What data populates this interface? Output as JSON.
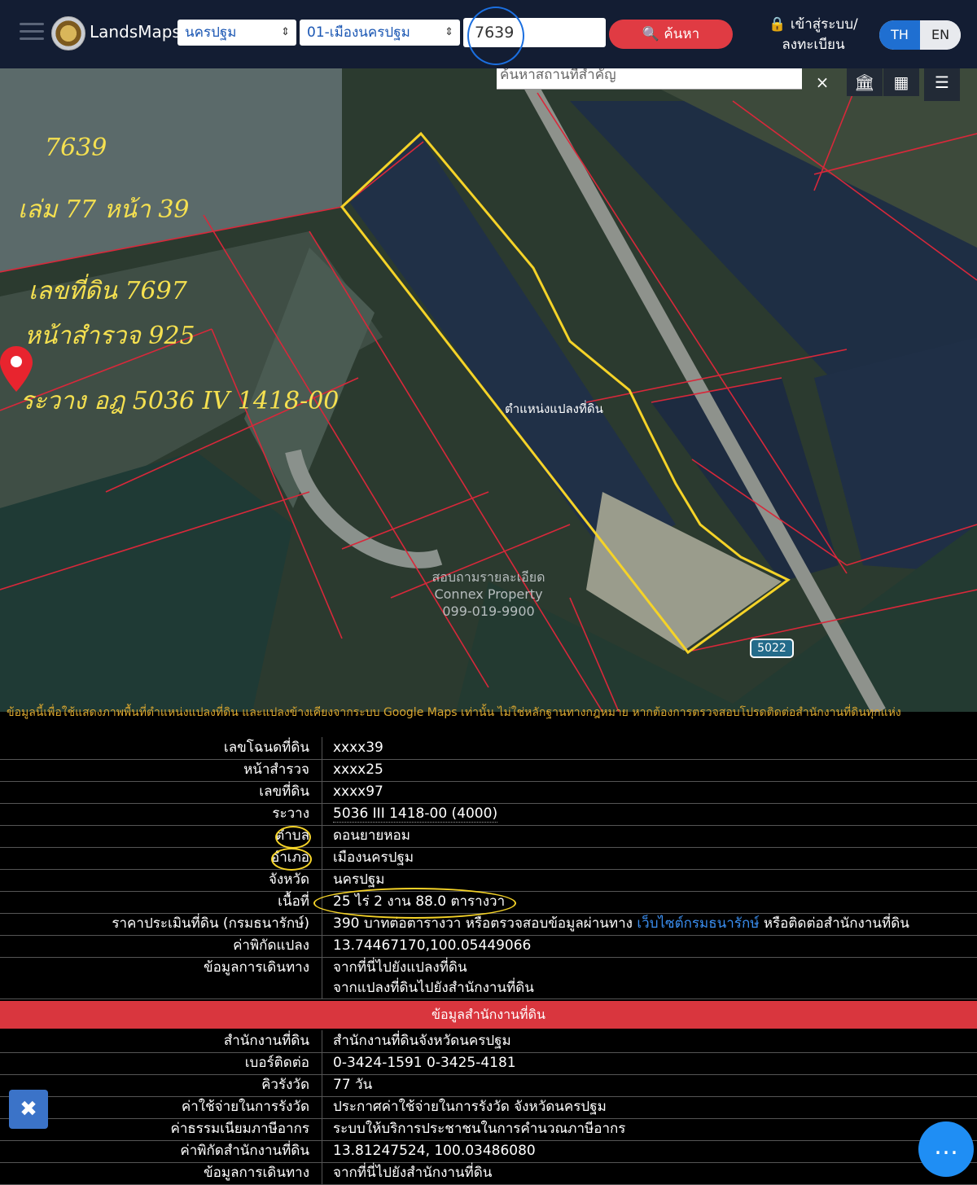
{
  "header": {
    "brand": "LandsMaps",
    "province_select": "นครปฐม",
    "district_select": "01-เมืองนครปฐม",
    "parcel_query": "7639",
    "search_button": "ค้นหา",
    "login": "เข้าสู่ระบบ/ลงทะเบียน",
    "lang_th": "TH",
    "lang_en": "EN"
  },
  "map": {
    "place_search_placeholder": "ค้นหาสถานที่สำคัญ",
    "clear_label": "×",
    "plot_label": "ตำแหน่งแปลงที่ดิน",
    "road_badge": "5022",
    "watermark_line1": "สอบถามรายละเอียด",
    "watermark_line2": "Connex Property",
    "watermark_line3": "099-019-9900",
    "handwritten": {
      "line1": "7639",
      "line2": "เล่ม 77 หน้า 39",
      "line3": "เลขที่ดิน 7697",
      "line4": "หน้าสำรวจ 925",
      "line5": "ระวาง  อฎ 5036 IV 1418-00"
    }
  },
  "disclaimer": "ข้อมูลนี้เพื่อใช้แสดงภาพพื้นที่ตำแหน่งแปลงที่ดิน และแปลงข้างเคียงจากระบบ Google Maps เท่านั้น ไม่ใช่หลักฐานทางกฎหมาย หากต้องการตรวจสอบโปรดติดต่อสำนักงานที่ดินทุกแห่ง",
  "parcel": [
    {
      "label": "เลขโฉนดที่ดิน",
      "value": "xxxx39"
    },
    {
      "label": "หน้าสำรวจ",
      "value": "xxxx25"
    },
    {
      "label": "เลขที่ดิน",
      "value": "xxxx97"
    },
    {
      "label": "ระวาง",
      "value": "5036 III 1418-00 (4000)"
    },
    {
      "label": "ตำบล",
      "value": "ดอนยายหอม"
    },
    {
      "label": "อำเภอ",
      "value": "เมืองนครปฐม"
    },
    {
      "label": "จังหวัด",
      "value": "นครปฐม"
    },
    {
      "label": "เนื้อที่",
      "value": "25 ไร่ 2 งาน 88.0 ตารางวา"
    }
  ],
  "price": {
    "label": "ราคาประเมินที่ดิน (กรมธนารักษ์)",
    "prefix": "390 บาทต่อตารางวา หรือตรวจสอบข้อมูลผ่านทาง ",
    "link": "เว็บไซต์กรมธนารักษ์",
    "suffix": " หรือติดต่อสำนักงานที่ดิน"
  },
  "coords": {
    "label": "ค่าพิกัดแปลง",
    "value": "13.74467170,100.05449066"
  },
  "travel": {
    "label": "ข้อมูลการเดินทาง",
    "link1": "จากที่นี่ไปยังแปลงที่ดิน",
    "link2": "จากแปลงที่ดินไปยังสำนักงานที่ดิน"
  },
  "office_section": {
    "title": "ข้อมูลสำนักงานที่ดิน",
    "rows": [
      {
        "label": "สำนักงานที่ดิน",
        "value": "สำนักงานที่ดินจังหวัดนครปฐม",
        "link": false
      },
      {
        "label": "เบอร์ติดต่อ",
        "value": "0-3424-1591 0-3425-4181",
        "link": true
      },
      {
        "label": "คิวรังวัด",
        "value": "77 วัน",
        "link": false
      },
      {
        "label": "ค่าใช้จ่ายในการรังวัด",
        "value": "ประกาศค่าใช้จ่ายในการรังวัด จังหวัดนครปฐม",
        "link": true
      },
      {
        "label": "ค่าธรรมเนียมภาษีอากร",
        "value": "ระบบให้บริการประชาชนในการคำนวณภาษีอากร",
        "link": true
      },
      {
        "label": "ค่าพิกัดสำนักงานที่ดิน",
        "value": "13.81247524, 100.03486080",
        "link": true
      },
      {
        "label": "ข้อมูลการเดินทาง",
        "value": "จากที่นี่ไปยังสำนักงานที่ดิน",
        "link": true
      }
    ]
  },
  "colors": {
    "accent": "#e03b43",
    "link": "#3a8ef0",
    "header_bg": "#131d33",
    "plot_outline": "#f5d328",
    "parcel_lines": "#d8283a"
  }
}
